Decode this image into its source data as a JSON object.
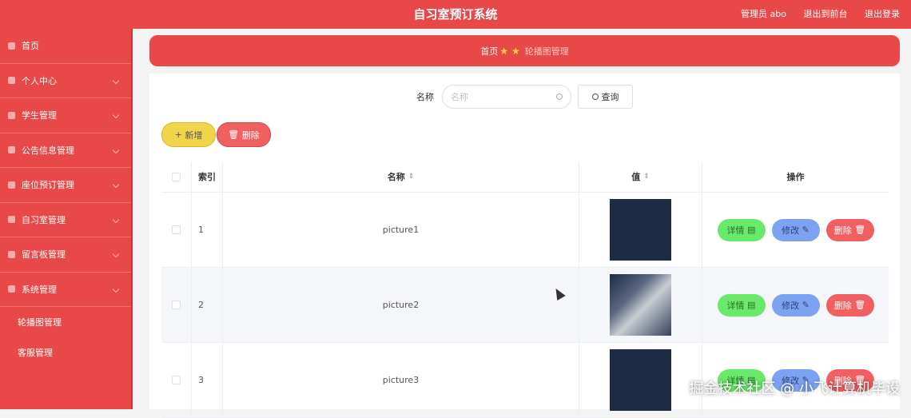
{
  "app": {
    "title": "自习室预订系统"
  },
  "header_links": [
    "管理员 abo",
    "退出到前台",
    "退出登录"
  ],
  "sidebar": {
    "items": [
      {
        "label": "首页"
      },
      {
        "label": "个人中心"
      },
      {
        "label": "学生管理"
      },
      {
        "label": "公告信息管理"
      },
      {
        "label": "座位预订管理"
      },
      {
        "label": "自习室管理"
      },
      {
        "label": "留言板管理"
      },
      {
        "label": "系统管理"
      }
    ],
    "subitems": [
      "轮播图管理",
      "客服管理"
    ]
  },
  "breadcrumb": {
    "home": "首页",
    "current": "轮播图管理"
  },
  "search": {
    "label": "名称",
    "placeholder": "名称",
    "button": "查询"
  },
  "toolbar": {
    "add": "新增",
    "delete": "删除"
  },
  "table": {
    "headers": {
      "index": "索引",
      "name": "名称",
      "value": "值",
      "actions": "操作"
    },
    "rows": [
      {
        "index": "1",
        "name": "picture1"
      },
      {
        "index": "2",
        "name": "picture2"
      },
      {
        "index": "3",
        "name": "picture3"
      }
    ],
    "actions": {
      "detail": "详情",
      "edit": "修改",
      "remove": "删除"
    }
  },
  "watermark": "掘金技术社区 @ 小飞计算机毕设",
  "colors": {
    "primary": "#e84848",
    "yellow": "#f0d44a",
    "green": "#6aea6a",
    "blue": "#7ea2f2",
    "red": "#f06060"
  }
}
